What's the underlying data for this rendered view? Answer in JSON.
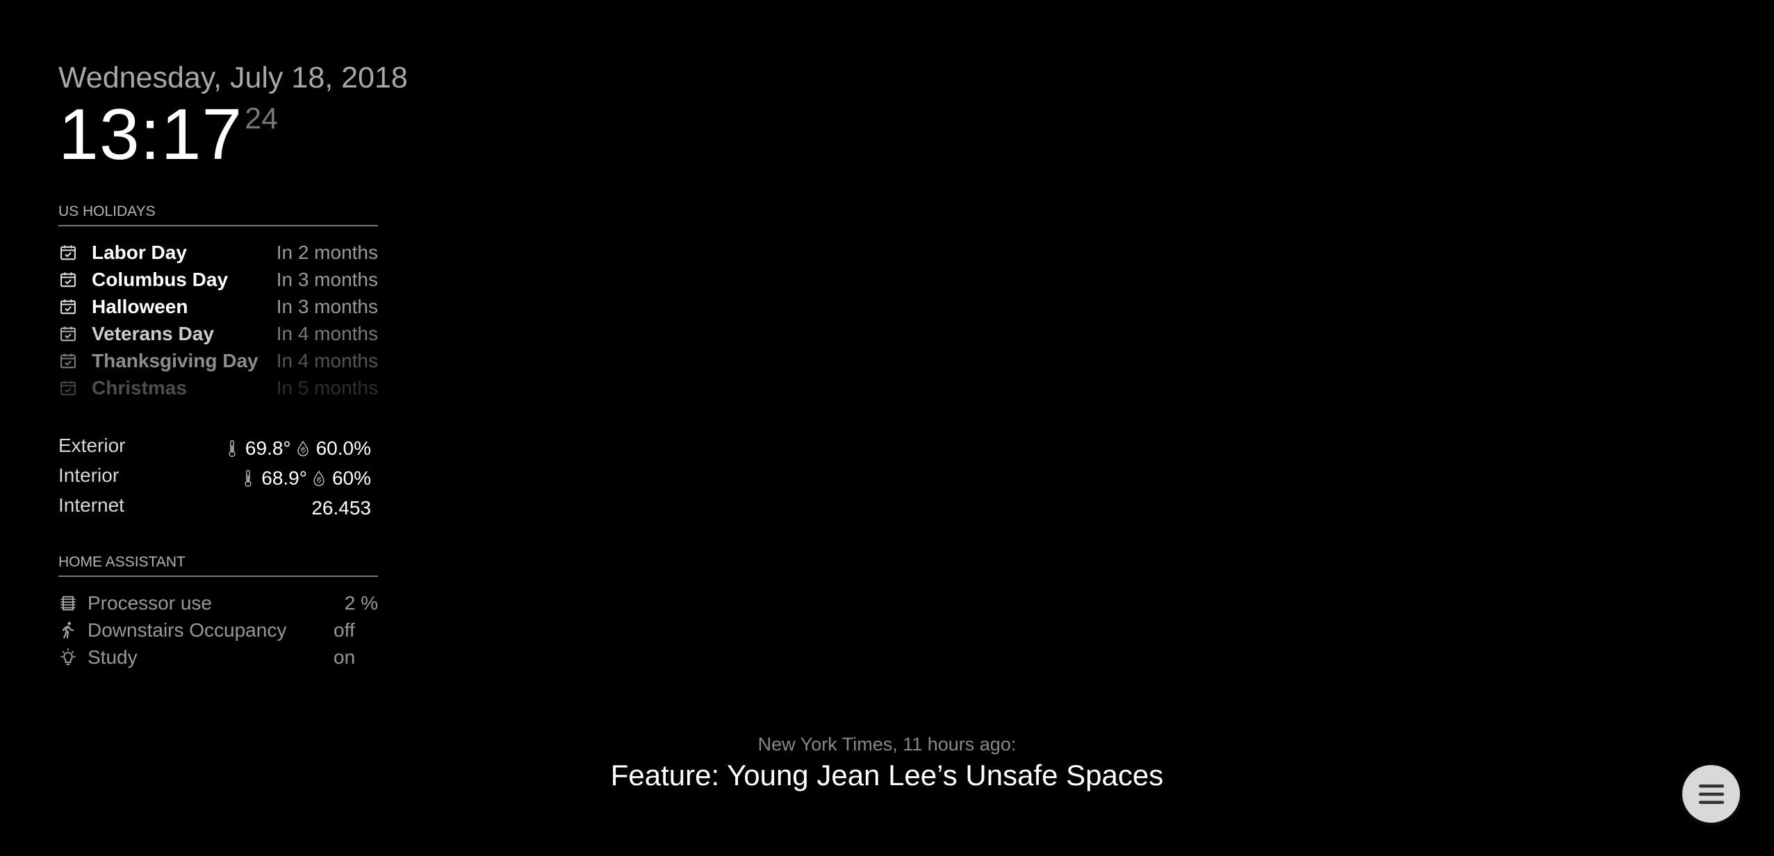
{
  "clock": {
    "date": "Wednesday, July 18, 2018",
    "time": "13:17",
    "seconds": "24"
  },
  "holidays": {
    "header": "US HOLIDAYS",
    "items": [
      {
        "name": "Labor Day",
        "when": "In 2 months",
        "icon": "calendar-check-icon"
      },
      {
        "name": "Columbus Day",
        "when": "In 3 months",
        "icon": "calendar-check-icon"
      },
      {
        "name": "Halloween",
        "when": "In 3 months",
        "icon": "calendar-check-icon"
      },
      {
        "name": "Veterans Day",
        "when": "In 4 months",
        "icon": "calendar-check-icon"
      },
      {
        "name": "Thanksgiving Day",
        "when": "In 4 months",
        "icon": "calendar-check-icon"
      },
      {
        "name": "Christmas",
        "when": "In 5 months",
        "icon": "calendar-check-icon"
      }
    ]
  },
  "sensors": {
    "rows": [
      {
        "label": "Exterior",
        "temperature": "69.8°",
        "humidity": "60.0%"
      },
      {
        "label": "Interior",
        "temperature": "68.9°",
        "humidity": "60%"
      },
      {
        "label": "Internet",
        "value": "26.453"
      }
    ]
  },
  "home_assistant": {
    "header": "HOME ASSISTANT",
    "items": [
      {
        "name": "Processor use",
        "state": "2 %",
        "icon": "processor-icon"
      },
      {
        "name": "Downstairs Occupancy",
        "state": "off",
        "icon": "walking-person-icon"
      },
      {
        "name": "Study",
        "state": "on",
        "icon": "lightbulb-icon"
      }
    ]
  },
  "news": {
    "source": "New York Times, 11 hours ago:",
    "headline": "Feature: Young Jean Lee’s Unsafe Spaces"
  },
  "menu": {
    "icon": "hamburger-menu-icon"
  },
  "colors": {
    "background": "#000000",
    "primary_text": "#ffffff",
    "dim_text": "#999999",
    "menu_button": "#d9d9d9"
  }
}
